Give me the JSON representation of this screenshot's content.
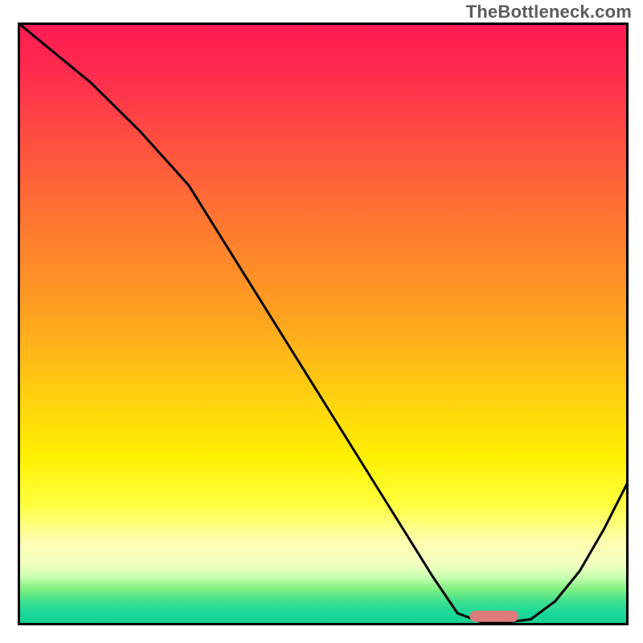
{
  "watermark": "TheBottleneck.com",
  "chart_data": {
    "type": "line",
    "title": "",
    "xlabel": "",
    "ylabel": "",
    "xlim": [
      0,
      100
    ],
    "ylim": [
      0,
      100
    ],
    "background_gradient": [
      "#ff1a52",
      "#ff5040",
      "#ffa020",
      "#ffd010",
      "#fff000",
      "#ffffb0",
      "#c8ffb0",
      "#40e090",
      "#10cf95"
    ],
    "series": [
      {
        "name": "bottleneck-curve",
        "color": "#000000",
        "x": [
          0,
          12,
          20,
          28,
          36,
          44,
          52,
          60,
          68,
          72,
          76,
          80,
          84,
          88,
          92,
          96,
          100
        ],
        "values": [
          100,
          90,
          82,
          73,
          60,
          47,
          34,
          21,
          8,
          2,
          0.5,
          0.5,
          1,
          4,
          9,
          16,
          24
        ]
      }
    ],
    "marker": {
      "name": "optimal-zone",
      "color": "#de7b7a",
      "x_start": 74,
      "x_end": 82,
      "y": 1.5,
      "shape": "rounded-bar"
    }
  }
}
